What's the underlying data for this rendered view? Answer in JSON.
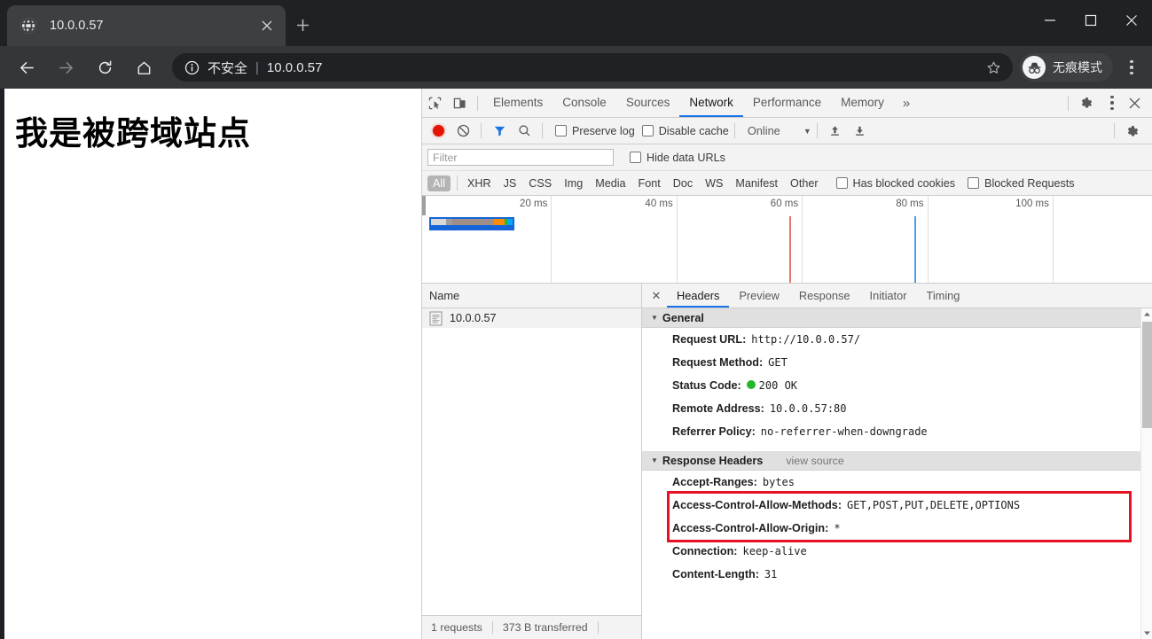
{
  "browser": {
    "tab": {
      "title": "10.0.0.57",
      "favicon_icon": "globe-icon",
      "close_icon": "close-icon"
    },
    "new_tab_label": "+",
    "window_controls": {
      "minimize": "minimize-icon",
      "maximize": "maximize-icon",
      "close": "close-icon"
    },
    "nav": {
      "back_icon": "back-arrow-icon",
      "forward_icon": "forward-arrow-icon",
      "reload_icon": "reload-icon",
      "home_icon": "home-icon"
    },
    "omnibox": {
      "security_icon": "info-circle-icon",
      "security_label": "不安全",
      "separator": "|",
      "url": "10.0.0.57",
      "bookmark_icon": "star-icon"
    },
    "incognito": {
      "icon": "incognito-hat-glasses-icon",
      "label": "无痕模式"
    },
    "menu_icon": "three-dots-vertical-icon"
  },
  "page": {
    "heading": "我是被跨域站点"
  },
  "devtools": {
    "inspect_icon": "inspect-element-icon",
    "device_toolbar_icon": "device-toolbar-icon",
    "panels": [
      {
        "label": "Elements",
        "active": false
      },
      {
        "label": "Console",
        "active": false
      },
      {
        "label": "Sources",
        "active": false
      },
      {
        "label": "Network",
        "active": true
      },
      {
        "label": "Performance",
        "active": false
      },
      {
        "label": "Memory",
        "active": false
      }
    ],
    "more_panels_label": "»",
    "settings_icon": "gear-icon",
    "dt_menu_icon": "three-dots-vertical-icon",
    "dt_close_icon": "close-icon",
    "network_toolbar": {
      "record_icon": "record-circle-icon",
      "clear_icon": "clear-no-entry-icon",
      "filter_icon": "funnel-filter-icon",
      "search_icon": "search-icon",
      "preserve_log_label": "Preserve log",
      "preserve_log_checked": false,
      "disable_cache_label": "Disable cache",
      "disable_cache_checked": false,
      "throttle_value": "Online",
      "throttle_caret_icon": "chevron-down-icon",
      "import_har_icon": "upload-arrow-icon",
      "export_har_icon": "download-arrow-icon",
      "network_settings_icon": "gear-icon"
    },
    "filter_bar": {
      "filter_placeholder": "Filter",
      "filter_value": "",
      "hide_data_urls_label": "Hide data URLs",
      "hide_data_urls_checked": false
    },
    "type_filters": [
      {
        "label": "All",
        "active": true
      },
      {
        "label": "XHR",
        "active": false
      },
      {
        "label": "JS",
        "active": false
      },
      {
        "label": "CSS",
        "active": false
      },
      {
        "label": "Img",
        "active": false
      },
      {
        "label": "Media",
        "active": false
      },
      {
        "label": "Font",
        "active": false
      },
      {
        "label": "Doc",
        "active": false
      },
      {
        "label": "WS",
        "active": false
      },
      {
        "label": "Manifest",
        "active": false
      },
      {
        "label": "Other",
        "active": false
      }
    ],
    "extra_filters": [
      {
        "label": "Has blocked cookies",
        "checked": false
      },
      {
        "label": "Blocked Requests",
        "checked": false
      }
    ],
    "overview": {
      "tick_labels": [
        "20 ms",
        "40 ms",
        "60 ms",
        "80 ms",
        "100 ms"
      ],
      "tick_values": [
        20,
        40,
        60,
        80,
        100
      ],
      "axis_max_ms": 116,
      "request_bar": {
        "start_ms": 0.5,
        "end_ms": 14.2,
        "segments": [
          {
            "name": "queueing",
            "color": "#d8d8d8",
            "ms": 2.6
          },
          {
            "name": "stalled",
            "color": "#9e9e9e",
            "ms": 1.1
          },
          {
            "name": "waiting-ttfb",
            "color": "#a08e88",
            "ms": 7.2
          },
          {
            "name": "content-download",
            "color": "#ff8c00",
            "ms": 1.8
          },
          {
            "name": "ssl",
            "color": "#1bbf3a",
            "ms": 0.5
          },
          {
            "name": "receiving",
            "color": "#0aa6f5",
            "ms": 1.0
          }
        ]
      },
      "dom_content_loaded_ms": 58,
      "dom_content_loaded_color": "#e57373",
      "load_event_ms": 78,
      "load_event_color": "#4f9bea"
    },
    "request_list": {
      "column_header": "Name",
      "rows": [
        {
          "icon": "document-icon",
          "name": "10.0.0.57",
          "selected": true
        }
      ],
      "status_bar": {
        "requests": "1 requests",
        "transferred": "373 B transferred"
      }
    },
    "detail": {
      "close_icon": "close-icon",
      "tabs": [
        {
          "label": "Headers",
          "active": true
        },
        {
          "label": "Preview",
          "active": false
        },
        {
          "label": "Response",
          "active": false
        },
        {
          "label": "Initiator",
          "active": false
        },
        {
          "label": "Timing",
          "active": false
        }
      ],
      "sections": [
        {
          "title": "General",
          "expanded": true,
          "view_source": "",
          "rows": [
            {
              "key": "Request URL:",
              "value": "http://10.0.0.57/"
            },
            {
              "key": "Request Method:",
              "value": "GET"
            },
            {
              "key": "Status Code:",
              "value": "200 OK",
              "status_dot": "#25b72a"
            },
            {
              "key": "Remote Address:",
              "value": "10.0.0.57:80"
            },
            {
              "key": "Referrer Policy:",
              "value": "no-referrer-when-downgrade"
            }
          ]
        },
        {
          "title": "Response Headers",
          "expanded": true,
          "view_source": "view source",
          "rows": [
            {
              "key": "Accept-Ranges:",
              "value": "bytes"
            },
            {
              "key": "Access-Control-Allow-Methods:",
              "value": "GET,POST,PUT,DELETE,OPTIONS",
              "highlighted": true
            },
            {
              "key": "Access-Control-Allow-Origin:",
              "value": "*",
              "highlighted": true
            },
            {
              "key": "Connection:",
              "value": "keep-alive"
            },
            {
              "key": "Content-Length:",
              "value": "31"
            }
          ]
        }
      ],
      "highlight_color": "#e81123"
    }
  }
}
